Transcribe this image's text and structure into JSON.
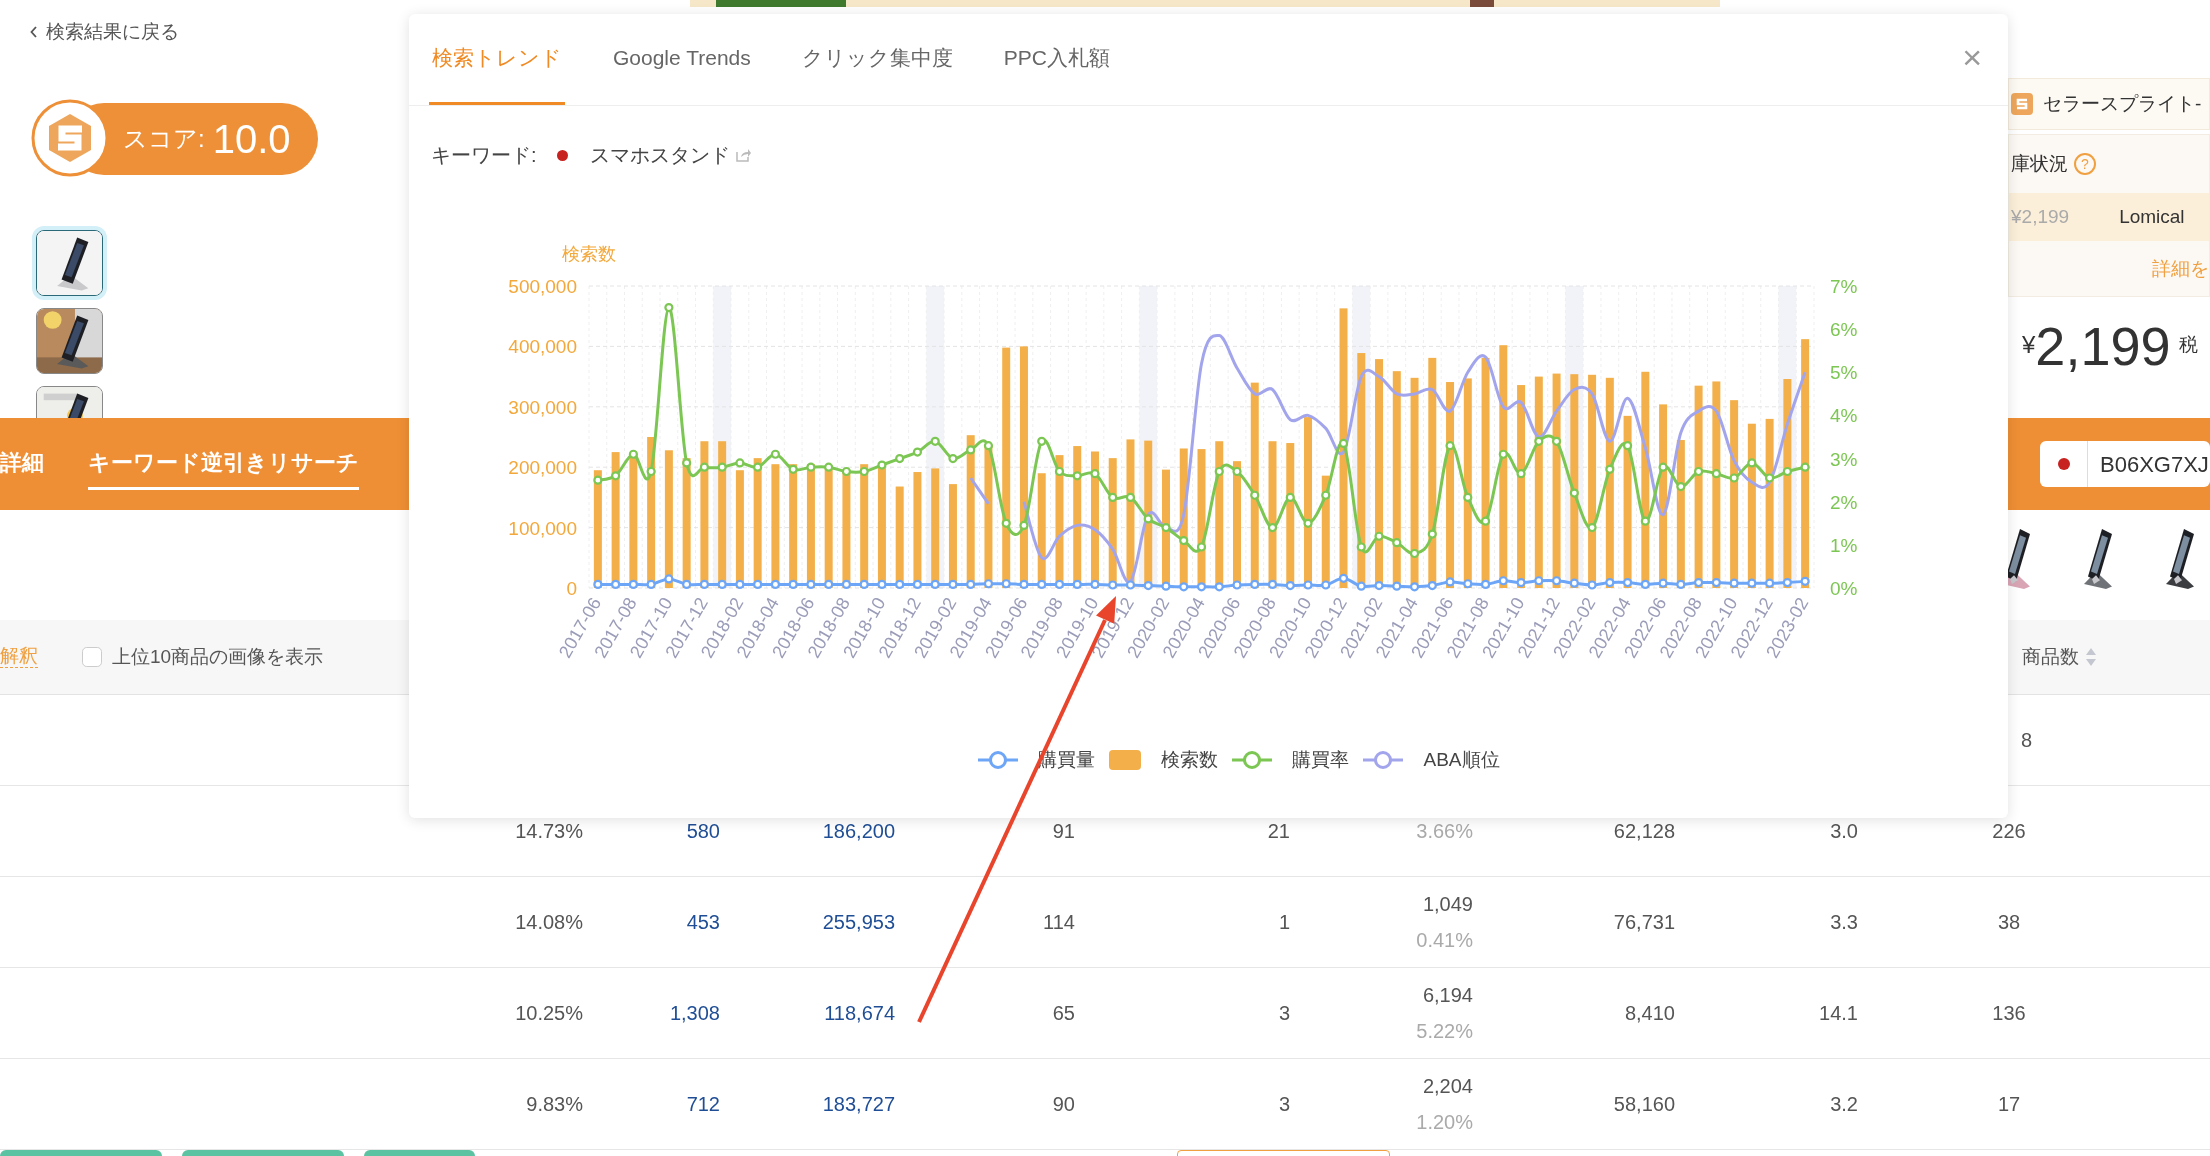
{
  "back_link": "検索結果に戻る",
  "score": {
    "label": "スコア:",
    "value": "10.0"
  },
  "thumbnails": [
    {
      "kind": "picture",
      "selected": true
    },
    {
      "kind": "picture",
      "selected": false
    },
    {
      "kind": "picture",
      "selected": false
    }
  ],
  "nav_tabs": [
    {
      "label": "詳細",
      "selected": false
    },
    {
      "label": "キーワード逆引きリサーチ",
      "selected": true
    }
  ],
  "seller_panel": {
    "title": "セラースプライト-",
    "stock_label": "庫状況",
    "help_icon": "?",
    "offer_price": "¥2,199",
    "seller": "Lomical",
    "details_link": "詳細を"
  },
  "price": {
    "currency": "¥",
    "amount": "2,199",
    "tax": "税"
  },
  "asin_field": {
    "value": "B06XG7XJ"
  },
  "product_images": [
    {
      "kind": "picture"
    },
    {
      "kind": "picture"
    },
    {
      "kind": "picture"
    }
  ],
  "table": {
    "explain_link": "解釈",
    "show_images": {
      "label": "上位10商品の画像を表示",
      "checked": false
    },
    "last_header": "商品数",
    "rows": [
      {
        "cells": [
          null,
          null,
          null,
          null,
          null,
          null,
          null,
          null,
          {
            "text": "8",
            "kind": "partial"
          }
        ]
      },
      {
        "cells": [
          {
            "text": "14.73%",
            "kind": "plain"
          },
          {
            "text": "580",
            "kind": "link"
          },
          {
            "text": "186,200",
            "kind": "link"
          },
          {
            "text": "91",
            "kind": "plain"
          },
          {
            "text": "21",
            "kind": "plain"
          },
          {
            "rate": "3.66%",
            "kind": "stacked"
          },
          {
            "text": "62,128",
            "kind": "plain"
          },
          {
            "text": "3.0",
            "kind": "plain"
          },
          {
            "text": "226",
            "kind": "plain"
          }
        ]
      },
      {
        "cells": [
          {
            "text": "14.08%",
            "kind": "plain"
          },
          {
            "text": "453",
            "kind": "link"
          },
          {
            "text": "255,953",
            "kind": "link"
          },
          {
            "text": "114",
            "kind": "plain"
          },
          {
            "text": "1",
            "kind": "plain"
          },
          {
            "text": "1,049",
            "rate": "0.41%",
            "kind": "stacked"
          },
          {
            "text": "76,731",
            "kind": "plain"
          },
          {
            "text": "3.3",
            "kind": "plain"
          },
          {
            "text": "38",
            "kind": "plain"
          }
        ]
      },
      {
        "cells": [
          {
            "text": "10.25%",
            "kind": "plain"
          },
          {
            "text": "1,308",
            "kind": "link"
          },
          {
            "text": "118,674",
            "kind": "link"
          },
          {
            "text": "65",
            "kind": "plain"
          },
          {
            "text": "3",
            "kind": "plain"
          },
          {
            "text": "6,194",
            "rate": "5.22%",
            "kind": "stacked"
          },
          {
            "text": "8,410",
            "kind": "plain"
          },
          {
            "text": "14.1",
            "kind": "plain"
          },
          {
            "text": "136",
            "kind": "plain"
          }
        ]
      },
      {
        "cells": [
          {
            "text": "9.83%",
            "kind": "plain"
          },
          {
            "text": "712",
            "kind": "link"
          },
          {
            "text": "183,727",
            "kind": "link"
          },
          {
            "text": "90",
            "kind": "plain"
          },
          {
            "text": "3",
            "kind": "plain"
          },
          {
            "text": "2,204",
            "rate": "1.20%",
            "kind": "stacked"
          },
          {
            "text": "58,160",
            "kind": "plain"
          },
          {
            "text": "3.2",
            "kind": "plain"
          },
          {
            "text": "17",
            "kind": "plain"
          }
        ]
      }
    ]
  },
  "modal": {
    "tabs": [
      {
        "label": "検索トレンド",
        "selected": true
      },
      {
        "label": "Google Trends",
        "selected": false
      },
      {
        "label": "クリック集中度",
        "selected": false
      },
      {
        "label": "PPC入札額",
        "selected": false
      }
    ],
    "close": "×",
    "keyword": {
      "label": "キーワード:",
      "value": "スマホスタンド"
    },
    "chart_data": {
      "type": "bar",
      "ylabel": "検索数",
      "categories": [
        "2017-06",
        null,
        "2017-08",
        null,
        "2017-10",
        null,
        "2017-12",
        null,
        "2018-02",
        null,
        "2018-04",
        null,
        "2018-06",
        null,
        "2018-08",
        null,
        "2018-10",
        null,
        "2018-12",
        null,
        "2019-02",
        null,
        "2019-04",
        null,
        "2019-06",
        null,
        "2019-08",
        null,
        "2019-10",
        null,
        "2019-12",
        null,
        "2020-02",
        null,
        "2020-04",
        null,
        "2020-06",
        null,
        "2020-08",
        null,
        "2020-10",
        null,
        "2020-12",
        null,
        "2021-02",
        null,
        "2021-04",
        null,
        "2021-06",
        null,
        "2021-08",
        null,
        "2021-10",
        null,
        "2021-12",
        null,
        "2022-02",
        null,
        "2022-04",
        null,
        "2022-06",
        null,
        "2022-08",
        null,
        "2022-10",
        null,
        "2022-12",
        null,
        "2023-02"
      ],
      "ylim": [
        0,
        500000
      ],
      "y2lim": [
        0,
        7
      ],
      "grid": true,
      "legend": "bottom",
      "yticks": [
        {
          "value": 0,
          "label": "0"
        },
        {
          "value": 100000,
          "label": "100,000"
        },
        {
          "value": 200000,
          "label": "200,000"
        },
        {
          "value": 300000,
          "label": "300,000"
        },
        {
          "value": 400000,
          "label": "400,000"
        },
        {
          "value": 500000,
          "label": "500,000"
        }
      ],
      "y2ticks": [
        {
          "value": 0,
          "label": "0%"
        },
        {
          "value": 1,
          "label": "1%"
        },
        {
          "value": 2,
          "label": "2%"
        },
        {
          "value": 3,
          "label": "3%"
        },
        {
          "value": 4,
          "label": "4%"
        },
        {
          "value": 5,
          "label": "5%"
        },
        {
          "value": 6,
          "label": "6%"
        },
        {
          "value": 7,
          "label": "7%"
        }
      ],
      "series": [
        {
          "name": "購買量",
          "color": "#6ea6f7",
          "type": "line",
          "marker": "circle",
          "values": [
            6000,
            6000,
            6000,
            6000,
            15000,
            6000,
            6000,
            6000,
            6000,
            6000,
            6000,
            6000,
            6000,
            6000,
            6000,
            6000,
            6000,
            6000,
            6000,
            6000,
            6000,
            6000,
            7000,
            7000,
            6000,
            6000,
            6000,
            6000,
            6000,
            5000,
            5000,
            4000,
            3000,
            2000,
            2000,
            2000,
            5000,
            6000,
            6000,
            4000,
            5000,
            5000,
            16000,
            3000,
            4000,
            3000,
            2000,
            4000,
            10000,
            7000,
            6000,
            12000,
            9000,
            12000,
            12000,
            8000,
            5000,
            9000,
            9000,
            6000,
            8000,
            6000,
            9000,
            9000,
            8000,
            8000,
            8000,
            9000,
            11000
          ]
        },
        {
          "name": "検索数",
          "color": "#f3b04a",
          "values": [
            195000,
            225000,
            220000,
            250000,
            228000,
            215000,
            243000,
            243000,
            195000,
            215000,
            205000,
            205000,
            205000,
            200000,
            195000,
            205000,
            200000,
            168000,
            192000,
            198000,
            172000,
            253000,
            235000,
            398000,
            400000,
            190000,
            220000,
            235000,
            226000,
            215000,
            246000,
            244000,
            196000,
            231000,
            230000,
            243000,
            210000,
            340000,
            243000,
            240000,
            283000,
            186000,
            463000,
            389000,
            379000,
            359000,
            348000,
            381000,
            341000,
            347000,
            381000,
            402000,
            336000,
            350000,
            355000,
            354000,
            353000,
            348000,
            285000,
            358000,
            304000,
            245000,
            335000,
            342000,
            311000,
            272000,
            280000,
            346000,
            412000
          ]
        },
        {
          "name": "購買率",
          "color": "#7cc653",
          "type": "line",
          "axis": "y2",
          "marker": "circle",
          "values": [
            2.5,
            2.6,
            3.1,
            2.7,
            6.5,
            2.9,
            2.8,
            2.8,
            2.9,
            2.8,
            3.1,
            2.75,
            2.8,
            2.8,
            2.7,
            2.7,
            2.85,
            3.0,
            3.15,
            3.4,
            3.0,
            3.2,
            3.3,
            1.5,
            1.45,
            3.4,
            2.7,
            2.6,
            2.65,
            2.1,
            2.1,
            1.6,
            1.4,
            1.1,
            0.95,
            2.7,
            2.7,
            2.15,
            1.4,
            2.1,
            1.5,
            2.15,
            3.35,
            0.95,
            1.2,
            1.05,
            0.8,
            1.25,
            3.3,
            2.1,
            1.55,
            3.1,
            2.65,
            3.4,
            3.4,
            2.2,
            1.4,
            2.75,
            3.3,
            1.55,
            2.8,
            2.35,
            2.7,
            2.65,
            2.55,
            2.9,
            2.55,
            2.7,
            2.8
          ]
        },
        {
          "name": "ABA順位",
          "color": "#a2a5ec",
          "type": "line",
          "axis": "y2",
          "marker": "none",
          "values": [
            null,
            null,
            null,
            null,
            null,
            null,
            null,
            null,
            null,
            null,
            null,
            null,
            null,
            null,
            null,
            null,
            null,
            null,
            null,
            null,
            null,
            2.55,
            1.95,
            null,
            2.0,
            0.7,
            1.2,
            1.45,
            1.35,
            0.9,
            0.15,
            1.7,
            1.4,
            1.7,
            5.2,
            5.85,
            5.1,
            4.5,
            4.6,
            3.9,
            4.0,
            3.7,
            3.15,
            4.9,
            4.9,
            4.5,
            4.5,
            4.6,
            4.1,
            5.0,
            5.35,
            4.2,
            4.3,
            3.5,
            4.1,
            4.6,
            4.5,
            3.4,
            4.4,
            3.25,
            1.7,
            3.6,
            4.1,
            4.1,
            2.95,
            2.45,
            2.45,
            3.8,
            5.0
          ]
        }
      ]
    }
  }
}
